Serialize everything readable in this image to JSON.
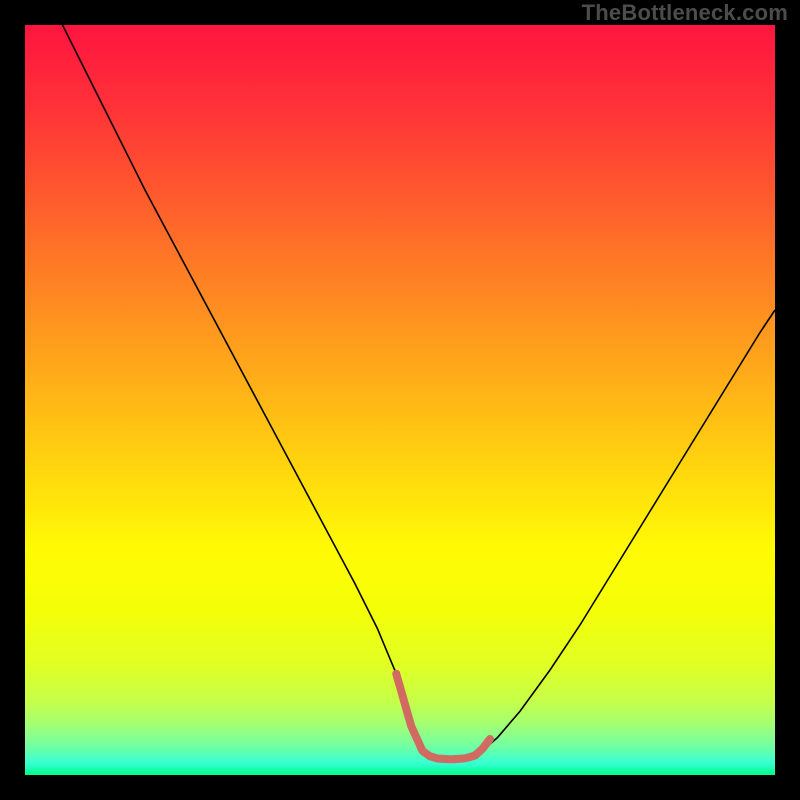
{
  "watermark": "TheBottleneck.com",
  "gradient_stops": [
    {
      "offset": 0.0,
      "color": "#ff153f"
    },
    {
      "offset": 0.1,
      "color": "#ff2f39"
    },
    {
      "offset": 0.2,
      "color": "#ff5030"
    },
    {
      "offset": 0.3,
      "color": "#ff7327"
    },
    {
      "offset": 0.4,
      "color": "#ff951f"
    },
    {
      "offset": 0.5,
      "color": "#ffb716"
    },
    {
      "offset": 0.6,
      "color": "#ffd90d"
    },
    {
      "offset": 0.7,
      "color": "#fffb04"
    },
    {
      "offset": 0.78,
      "color": "#f4ff07"
    },
    {
      "offset": 0.85,
      "color": "#e2ff23"
    },
    {
      "offset": 0.9,
      "color": "#c7ff47"
    },
    {
      "offset": 0.93,
      "color": "#a6ff6f"
    },
    {
      "offset": 0.96,
      "color": "#76ffa0"
    },
    {
      "offset": 0.985,
      "color": "#34ffd4"
    },
    {
      "offset": 1.0,
      "color": "#00ff83"
    }
  ],
  "chart_data": {
    "type": "line",
    "title": "",
    "xlabel": "",
    "ylabel": "",
    "xlim": [
      0,
      100
    ],
    "ylim": [
      0,
      100
    ],
    "series": [
      {
        "name": "curve",
        "stroke": "#000000",
        "stroke_width": 1.6,
        "x": [
          5,
          8,
          12,
          16,
          20,
          24,
          28,
          32,
          36,
          40,
          44,
          47,
          49.5,
          51,
          52,
          53,
          55,
          57,
          59,
          60.5,
          63,
          66,
          70,
          74,
          78,
          82,
          86,
          90,
          94,
          98,
          100
        ],
        "y": [
          100,
          94,
          86,
          78,
          70.5,
          63,
          55.5,
          48,
          40.5,
          33,
          25.5,
          19.5,
          13.5,
          8.5,
          5,
          3,
          2.2,
          2.1,
          2.2,
          2.8,
          5,
          8.5,
          14,
          20,
          26.5,
          33,
          39.5,
          46,
          52.5,
          59,
          62
        ]
      },
      {
        "name": "marker-strip",
        "stroke": "#d16a61",
        "stroke_width": 8,
        "linecap": "round",
        "x": [
          49.5,
          51.5,
          53,
          54,
          55,
          56.5,
          57,
          58.5,
          59,
          60,
          61,
          62
        ],
        "y": [
          13.5,
          6.5,
          3.2,
          2.5,
          2.2,
          2.1,
          2.1,
          2.2,
          2.3,
          2.6,
          3.5,
          4.8
        ]
      }
    ]
  }
}
